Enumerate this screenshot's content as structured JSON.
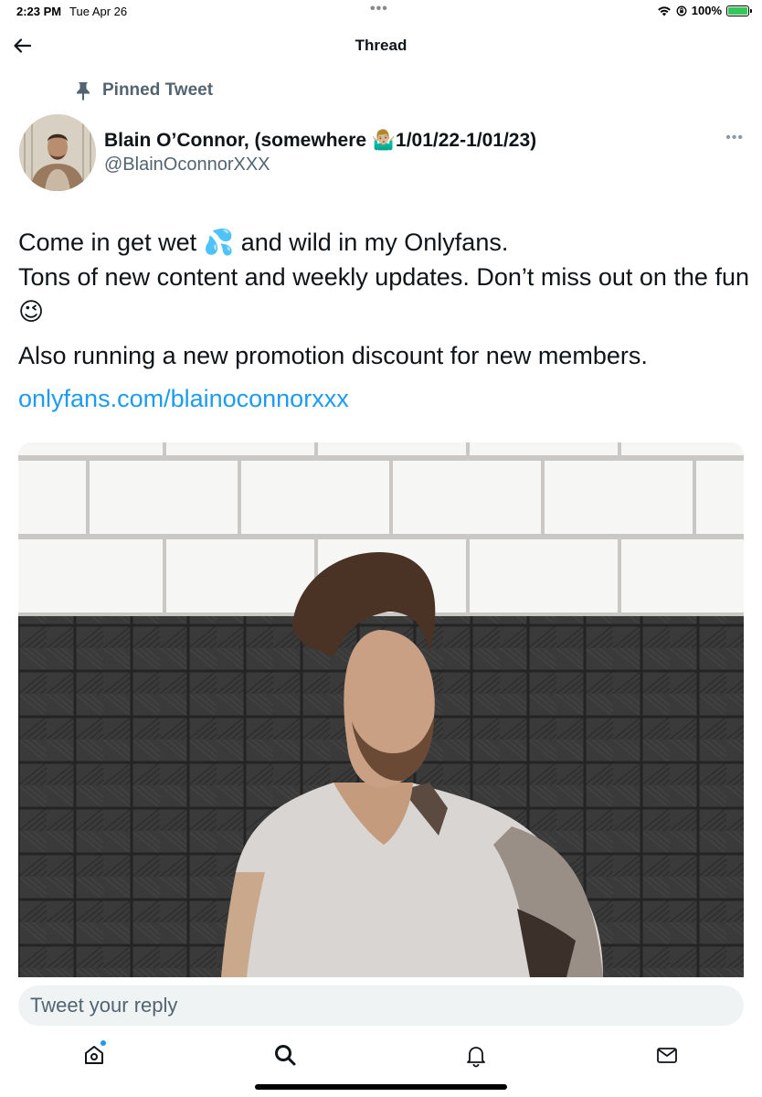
{
  "status_bar": {
    "time": "2:23 PM",
    "date": "Tue Apr 26",
    "battery": "100%",
    "battery_level": 1.0
  },
  "nav": {
    "title": "Thread",
    "back_icon": "arrow-left-icon"
  },
  "tweet": {
    "pinned_label": "Pinned Tweet",
    "author_name": "Blain O’Connor, (somewhere 🤷🏼‍♂️1/01/22-1/01/23)",
    "author_handle": "@BlainOconnorXXX",
    "text_line1": "Come in get wet 💦 and wild in my Onlyfans.",
    "text_line2": "Tons of new content and weekly updates. Don’t miss out on the fun 😉",
    "text_line3": "Also running a new promotion discount for new members.",
    "link": "onlyfans.com/blainoconnorxxx",
    "more_icon": "more-horizontal-icon"
  },
  "reply": {
    "placeholder": "Tweet your reply"
  },
  "tab_bar": {
    "items": [
      {
        "icon": "home-icon"
      },
      {
        "icon": "search-icon"
      },
      {
        "icon": "notifications-bell-icon"
      },
      {
        "icon": "messages-envelope-icon"
      }
    ]
  },
  "colors": {
    "link": "#1d9bf0",
    "secondary_text": "#536471",
    "reply_bg": "#eff3f4"
  }
}
